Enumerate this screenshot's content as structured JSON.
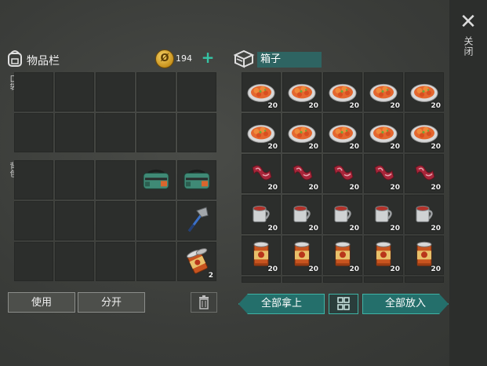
{
  "close": {
    "label": "关闭"
  },
  "inventory": {
    "title": "物品栏",
    "coins": "194",
    "pocket_label": "口袋",
    "backpack_label": "背包",
    "items": [
      {
        "slot": 9,
        "icon": "green-backpack-icon",
        "qty": ""
      },
      {
        "slot": 10,
        "icon": "green-backpack-icon",
        "qty": ""
      },
      {
        "slot": 15,
        "icon": "hatchet-icon",
        "qty": ""
      },
      {
        "slot": 20,
        "icon": "open-can-icon",
        "qty": "2"
      }
    ]
  },
  "actions": {
    "use_label": "使用",
    "split_label": "分开"
  },
  "box": {
    "title": "箱子",
    "rows": [
      {
        "icon": "food-plate-icon",
        "qtys": [
          "20",
          "20",
          "20",
          "20",
          "20"
        ]
      },
      {
        "icon": "food-plate-icon",
        "qtys": [
          "20",
          "20",
          "20",
          "20",
          "20"
        ]
      },
      {
        "icon": "raw-meat-icon",
        "qtys": [
          "20",
          "20",
          "20",
          "20",
          "20"
        ]
      },
      {
        "icon": "tin-cup-icon",
        "qtys": [
          "20",
          "20",
          "20",
          "20",
          "20"
        ]
      },
      {
        "icon": "canned-food-icon",
        "qtys": [
          "20",
          "20",
          "20",
          "20",
          "20"
        ]
      }
    ],
    "take_all_label": "全部拿上",
    "put_all_label": "全部放入"
  },
  "colors": {
    "accent": "#35c4a5",
    "teal_button": "#246f6b",
    "slot_bg": "#2c2e2c"
  }
}
